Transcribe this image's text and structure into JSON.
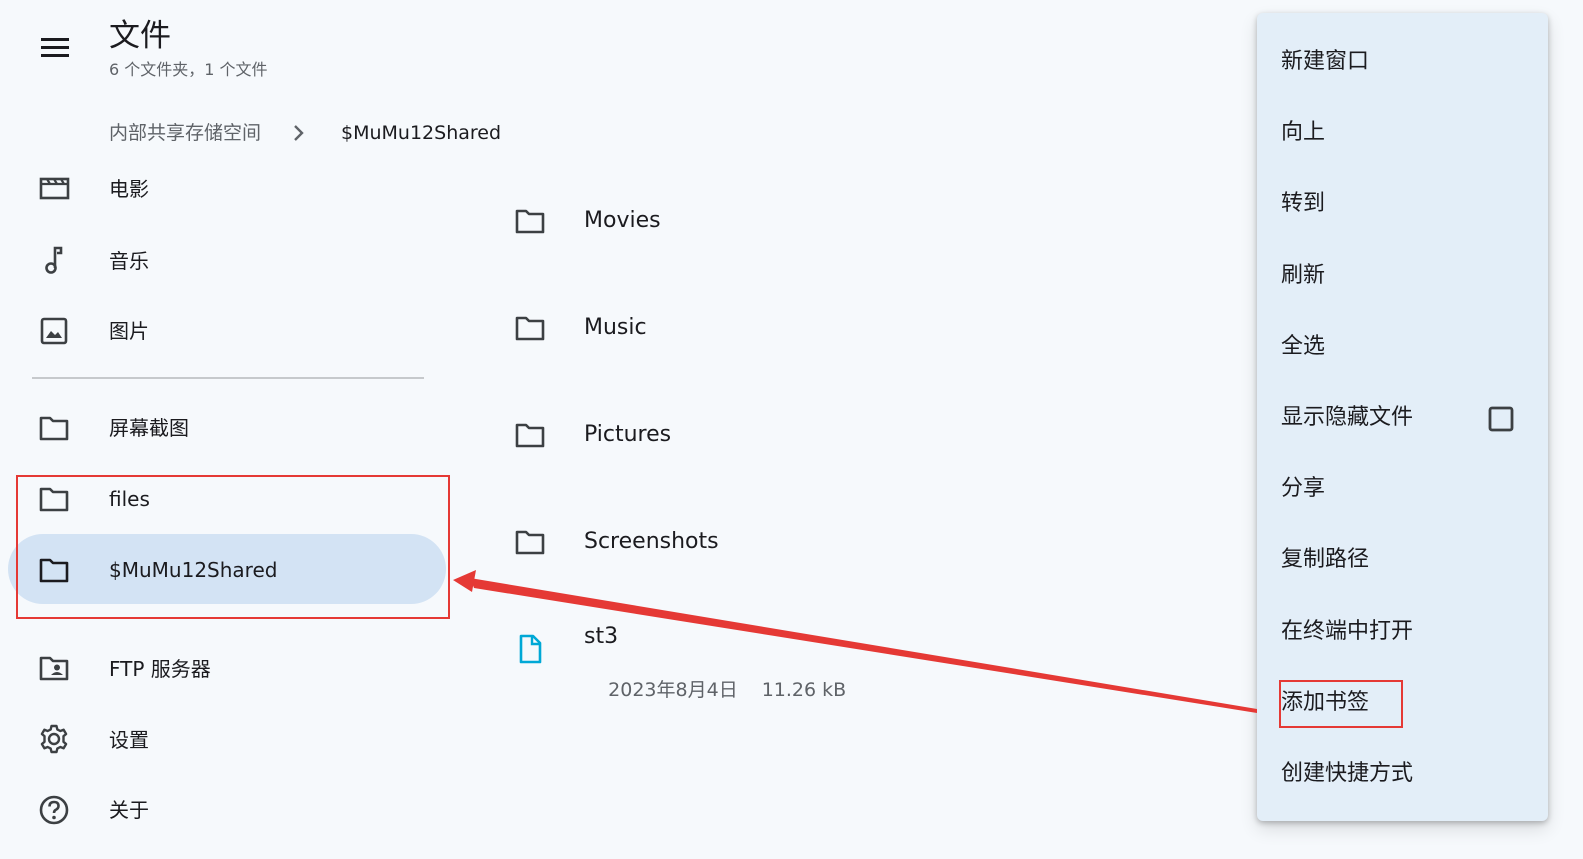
{
  "header": {
    "title": "文件",
    "subtitle": "6 个文件夹，1 个文件",
    "menu_icon": "hamburger-menu-icon"
  },
  "breadcrumb": {
    "items": [
      "内部共享存储空间",
      "$MuMu12Shared"
    ],
    "separator_icon": "chevron-right-icon"
  },
  "sidebar": {
    "items": [
      {
        "label": "电影",
        "icon": "movie-icon"
      },
      {
        "label": "音乐",
        "icon": "music-note-icon"
      },
      {
        "label": "图片",
        "icon": "image-icon"
      },
      {
        "label": "屏幕截图",
        "icon": "folder-icon"
      },
      {
        "label": "files",
        "icon": "folder-icon"
      },
      {
        "label": "$MuMu12Shared",
        "icon": "folder-icon",
        "active": true
      },
      {
        "label": "FTP 服务器",
        "icon": "ftp-server-icon"
      },
      {
        "label": "设置",
        "icon": "gear-icon"
      },
      {
        "label": "关于",
        "icon": "help-icon"
      }
    ]
  },
  "files": {
    "items": [
      {
        "name": "Movies",
        "type": "folder"
      },
      {
        "name": "Music",
        "type": "folder"
      },
      {
        "name": "Pictures",
        "type": "folder"
      },
      {
        "name": "Screenshots",
        "type": "folder"
      },
      {
        "name": "st3",
        "type": "file",
        "date": "2023年8月4日",
        "size": "11.26 kB"
      }
    ]
  },
  "context_menu": {
    "items": [
      {
        "label": "新建窗口"
      },
      {
        "label": "向上"
      },
      {
        "label": "转到"
      },
      {
        "label": "刷新"
      },
      {
        "label": "全选"
      },
      {
        "label": "显示隐藏文件",
        "checkbox": false
      },
      {
        "label": "分享"
      },
      {
        "label": "复制路径"
      },
      {
        "label": "在终端中打开"
      },
      {
        "label": "添加书签"
      },
      {
        "label": "创建快捷方式"
      }
    ]
  },
  "colors": {
    "background": "#f6f9fc",
    "active_item": "#d3e3f4",
    "menu_background": "#e3eef8",
    "annotation_red": "#e53935",
    "file_icon": "#00a8d6"
  }
}
